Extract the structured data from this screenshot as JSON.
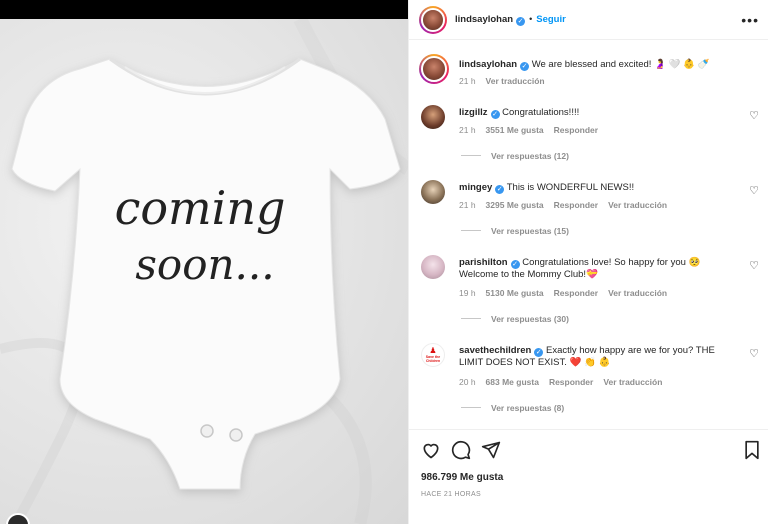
{
  "photo": {
    "text_line1": "coming",
    "text_line2": "soon..."
  },
  "post": {
    "username": "lindsaylohan",
    "follow_label": "Seguir",
    "dot": "•",
    "more_icon": "more-horizontal-icon",
    "caption": "We are blessed and excited! 🤰 🤍 👶 🍼",
    "caption_time": "21 h",
    "caption_translate": "Ver traducción"
  },
  "comments": [
    {
      "username": "lizgillz",
      "verified": true,
      "text": "Congratulations!!!!",
      "time": "21 h",
      "likes": "3551 Me gusta",
      "reply": "Responder",
      "translate": "",
      "replies": "Ver respuestas (12)"
    },
    {
      "username": "mingey",
      "verified": true,
      "text": "This is WONDERFUL NEWS!!",
      "time": "21 h",
      "likes": "3295 Me gusta",
      "reply": "Responder",
      "translate": "Ver traducción",
      "replies": "Ver respuestas (15)"
    },
    {
      "username": "parishilton",
      "verified": true,
      "text": "Congratulations love! So happy for you 🥺 Welcome to the Mommy Club!💝",
      "time": "19 h",
      "likes": "5130 Me gusta",
      "reply": "Responder",
      "translate": "Ver traducción",
      "replies": "Ver respuestas (30)"
    },
    {
      "username": "savethechildren",
      "verified": true,
      "avatar_text": "Save the Children",
      "text": "Exactly how happy are we for you? THE LIMIT DOES NOT EXIST. ❤️ 👏 👶",
      "time": "20 h",
      "likes": "683 Me gusta",
      "reply": "Responder",
      "translate": "Ver traducción",
      "replies": "Ver respuestas (8)"
    }
  ],
  "footer": {
    "likes": "986.799 Me gusta",
    "time_ago": "HACE 21 HORAS"
  },
  "colors": {
    "accent": "#0095f6",
    "verified": "#3897f0",
    "muted": "#8e8e8e"
  }
}
